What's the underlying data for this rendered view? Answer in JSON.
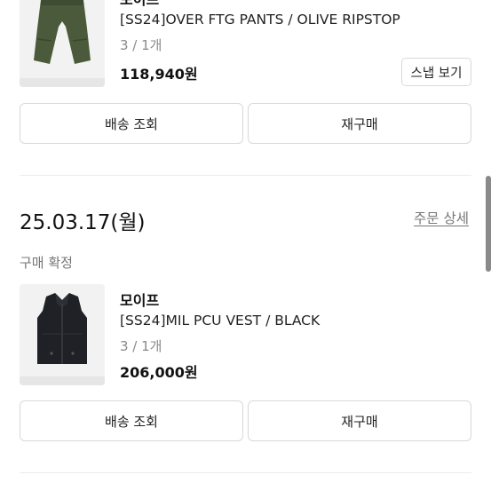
{
  "orders": [
    {
      "brand": "모이프",
      "product_name": "[SS24]OVER FTG PANTS / OLIVE RIPSTOP",
      "quantity": "3 / 1개",
      "price": "118,940원",
      "snap_label": "스냅 보기",
      "shipping_label": "배송 조회",
      "reorder_label": "재구매",
      "item_color": "#4a5a3a"
    },
    {
      "date": "25.03.17(월)",
      "detail_link": "주문 상세",
      "status": "구매 확정",
      "brand": "모이프",
      "product_name": "[SS24]MIL PCU VEST / BLACK",
      "quantity": "3 / 1개",
      "price": "206,000원",
      "shipping_label": "배송 조회",
      "reorder_label": "재구매",
      "item_color": "#1f2126"
    }
  ]
}
